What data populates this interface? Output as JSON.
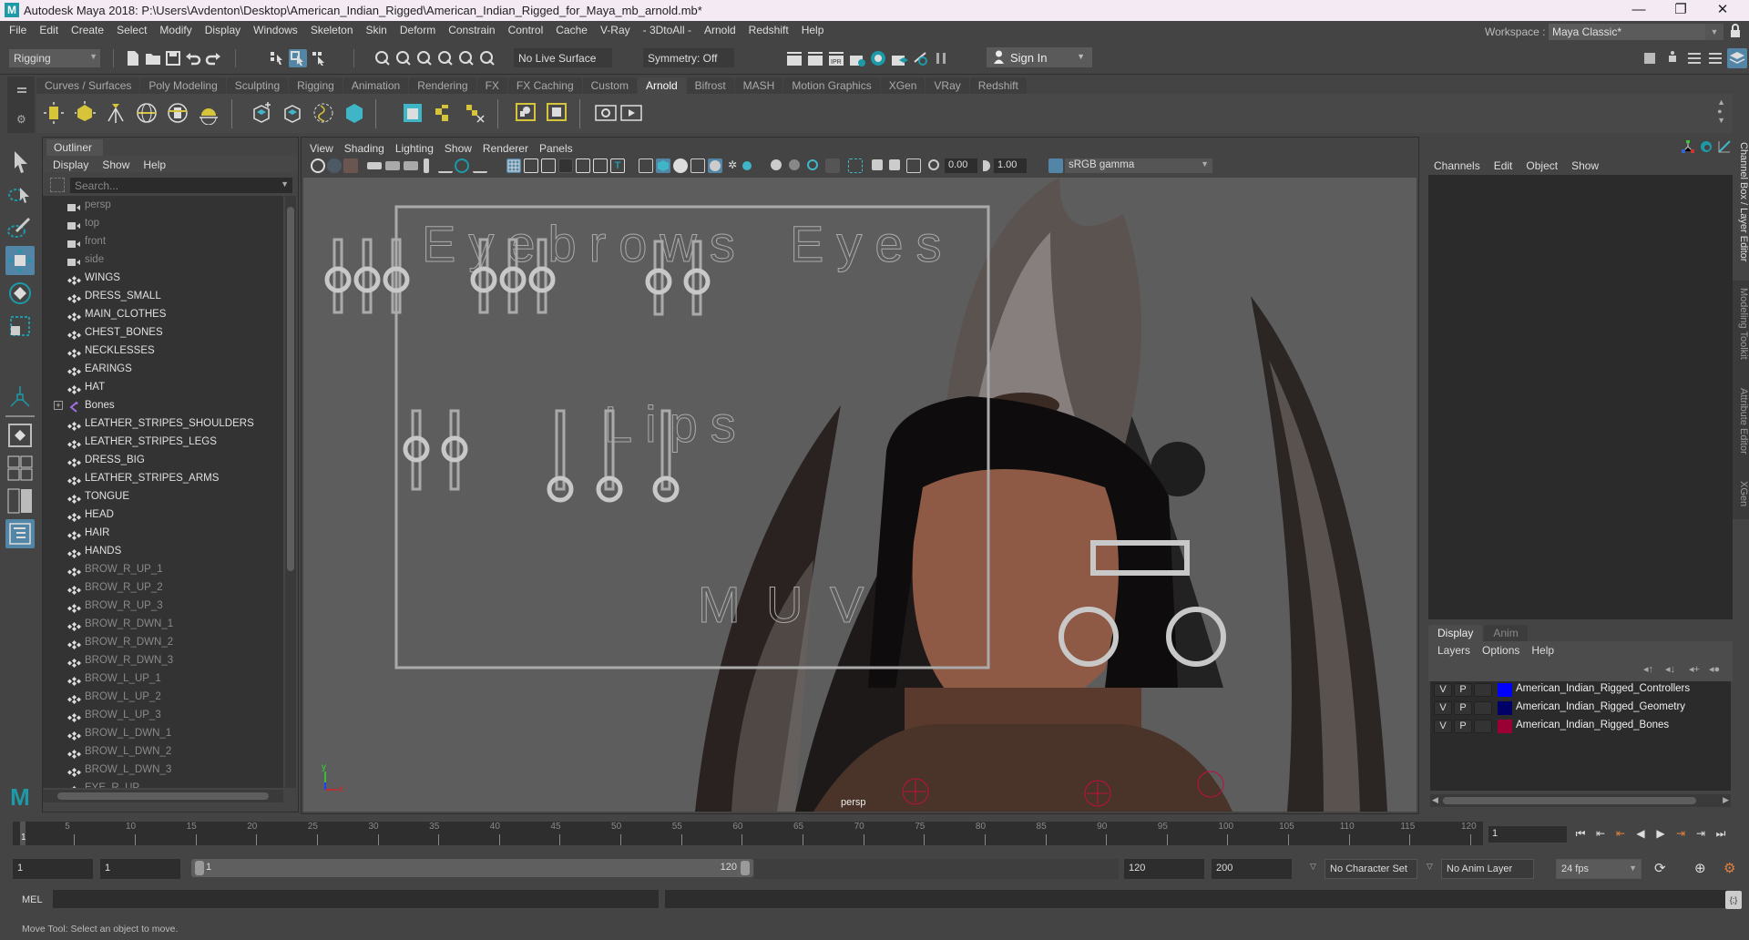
{
  "window": {
    "title": "Autodesk Maya 2018: P:\\Users\\Avdenton\\Desktop\\American_Indian_Rigged\\American_Indian_Rigged_for_Maya_mb_arnold.mb*",
    "logo": "M",
    "minimize": "—",
    "maximize": "❐",
    "close": "✕"
  },
  "menubar": {
    "items": [
      "File",
      "Edit",
      "Create",
      "Select",
      "Modify",
      "Display",
      "Windows",
      "Skeleton",
      "Skin",
      "Deform",
      "Constrain",
      "Control",
      "Cache",
      "V-Ray",
      "- 3DtoAll -",
      "Arnold",
      "Redshift",
      "Help"
    ],
    "workspace_label": "Workspace :",
    "workspace_value": "Maya Classic*"
  },
  "statusline": {
    "mode": "Rigging",
    "live_surface": "No Live Surface",
    "symmetry": "Symmetry: Off",
    "sign_in": "Sign In"
  },
  "shelf": {
    "tabs": [
      "Curves / Surfaces",
      "Poly Modeling",
      "Sculpting",
      "Rigging",
      "Animation",
      "Rendering",
      "FX",
      "FX Caching",
      "Custom",
      "Arnold",
      "Bifrost",
      "MASH",
      "Motion Graphics",
      "XGen",
      "VRay",
      "Redshift"
    ],
    "active_tab": "Arnold",
    "icons": [
      "area-light-icon",
      "mesh-light-icon",
      "photometric-light-icon",
      "skydome-light-icon",
      "light-portal-icon",
      "physical-sky-icon",
      "create-standin-icon",
      "export-standin-icon",
      "curve-collector-icon",
      "volume-icon",
      "render-view-icon",
      "txmanager-icon",
      "flush-texture-icon",
      "light-manager-icon",
      "shader-icon",
      "render-icon",
      "ipr-icon"
    ]
  },
  "outliner": {
    "tab": "Outliner",
    "menu": [
      "Display",
      "Show",
      "Help"
    ],
    "search_placeholder": "Search...",
    "items": [
      {
        "label": "persp",
        "type": "camera",
        "dim": true
      },
      {
        "label": "top",
        "type": "camera",
        "dim": true
      },
      {
        "label": "front",
        "type": "camera",
        "dim": true
      },
      {
        "label": "side",
        "type": "camera",
        "dim": true
      },
      {
        "label": "WINGS",
        "type": "mesh",
        "dim": false
      },
      {
        "label": "DRESS_SMALL",
        "type": "mesh",
        "dim": false
      },
      {
        "label": "MAIN_CLOTHES",
        "type": "mesh",
        "dim": false
      },
      {
        "label": "CHEST_BONES",
        "type": "mesh",
        "dim": false
      },
      {
        "label": "NECKLESSES",
        "type": "mesh",
        "dim": false
      },
      {
        "label": "EARINGS",
        "type": "mesh",
        "dim": false
      },
      {
        "label": "HAT",
        "type": "mesh",
        "dim": false
      },
      {
        "label": "Bones",
        "type": "joint",
        "dim": false,
        "expandable": true
      },
      {
        "label": "LEATHER_STRIPES_SHOULDERS",
        "type": "mesh",
        "dim": false
      },
      {
        "label": "LEATHER_STRIPES_LEGS",
        "type": "mesh",
        "dim": false
      },
      {
        "label": "DRESS_BIG",
        "type": "mesh",
        "dim": false
      },
      {
        "label": "LEATHER_STRIPES_ARMS",
        "type": "mesh",
        "dim": false
      },
      {
        "label": "TONGUE",
        "type": "mesh",
        "dim": false
      },
      {
        "label": "HEAD",
        "type": "mesh",
        "dim": false
      },
      {
        "label": "HAIR",
        "type": "mesh",
        "dim": false
      },
      {
        "label": "HANDS",
        "type": "mesh",
        "dim": false
      },
      {
        "label": "BROW_R_UP_1",
        "type": "mesh",
        "dim": true
      },
      {
        "label": "BROW_R_UP_2",
        "type": "mesh",
        "dim": true
      },
      {
        "label": "BROW_R_UP_3",
        "type": "mesh",
        "dim": true
      },
      {
        "label": "BROW_R_DWN_1",
        "type": "mesh",
        "dim": true
      },
      {
        "label": "BROW_R_DWN_2",
        "type": "mesh",
        "dim": true
      },
      {
        "label": "BROW_R_DWN_3",
        "type": "mesh",
        "dim": true
      },
      {
        "label": "BROW_L_UP_1",
        "type": "mesh",
        "dim": true
      },
      {
        "label": "BROW_L_UP_2",
        "type": "mesh",
        "dim": true
      },
      {
        "label": "BROW_L_UP_3",
        "type": "mesh",
        "dim": true
      },
      {
        "label": "BROW_L_DWN_1",
        "type": "mesh",
        "dim": true
      },
      {
        "label": "BROW_L_DWN_2",
        "type": "mesh",
        "dim": true
      },
      {
        "label": "BROW_L_DWN_3",
        "type": "mesh",
        "dim": true
      },
      {
        "label": "EYE_R_UP",
        "type": "mesh",
        "dim": true
      }
    ]
  },
  "viewport": {
    "menu": [
      "View",
      "Shading",
      "Lighting",
      "Show",
      "Renderer",
      "Panels"
    ],
    "exposure": "0.00",
    "gamma": "1.00",
    "color_space": "sRGB gamma",
    "camera_label": "persp",
    "face_ui": {
      "eyebrows_label": "Eyebrows",
      "eyes_label": "Eyes",
      "lips_label": "Lips",
      "muv_labels": [
        "M",
        "U",
        "V"
      ]
    },
    "axis": {
      "x": "x",
      "y": "y",
      "z": "z"
    }
  },
  "channel_box": {
    "menu": [
      "Channels",
      "Edit",
      "Object",
      "Show"
    ]
  },
  "layer_editor": {
    "tabs": [
      "Display",
      "Anim"
    ],
    "active_tab": "Display",
    "menu": [
      "Layers",
      "Options",
      "Help"
    ],
    "layers": [
      {
        "v": "V",
        "p": "P",
        "color": "#0000ff",
        "name": "American_Indian_Rigged_Controllers"
      },
      {
        "v": "V",
        "p": "P",
        "color": "#000066",
        "name": "American_Indian_Rigged_Geometry"
      },
      {
        "v": "V",
        "p": "P",
        "color": "#990033",
        "name": "American_Indian_Rigged_Bones"
      }
    ]
  },
  "side_tabs": [
    "Channel Box / Layer Editor",
    "Modeling Toolkit",
    "Attribute Editor",
    "XGen"
  ],
  "timeline": {
    "ticks": [
      5,
      10,
      15,
      20,
      25,
      30,
      35,
      40,
      45,
      50,
      55,
      60,
      65,
      70,
      75,
      80,
      85,
      90,
      95,
      100,
      105,
      110,
      115,
      120
    ],
    "start": 1,
    "end": 120,
    "current_frame_marker": "1",
    "current_frame": "1"
  },
  "range": {
    "scene_start": "1",
    "playback_start": "1",
    "slider_start": "1",
    "slider_end": "120",
    "playback_end": "120",
    "scene_end": "200",
    "character_set": "No Character Set",
    "anim_layer": "No Anim Layer",
    "fps": "24 fps"
  },
  "command_line": {
    "language": "MEL"
  },
  "help_line": {
    "text": "Move Tool: Select an object to move."
  },
  "colors": {
    "accent": "#5285a6",
    "teal": "#1d9aa8",
    "arnold_yellow": "#d6c53a"
  }
}
